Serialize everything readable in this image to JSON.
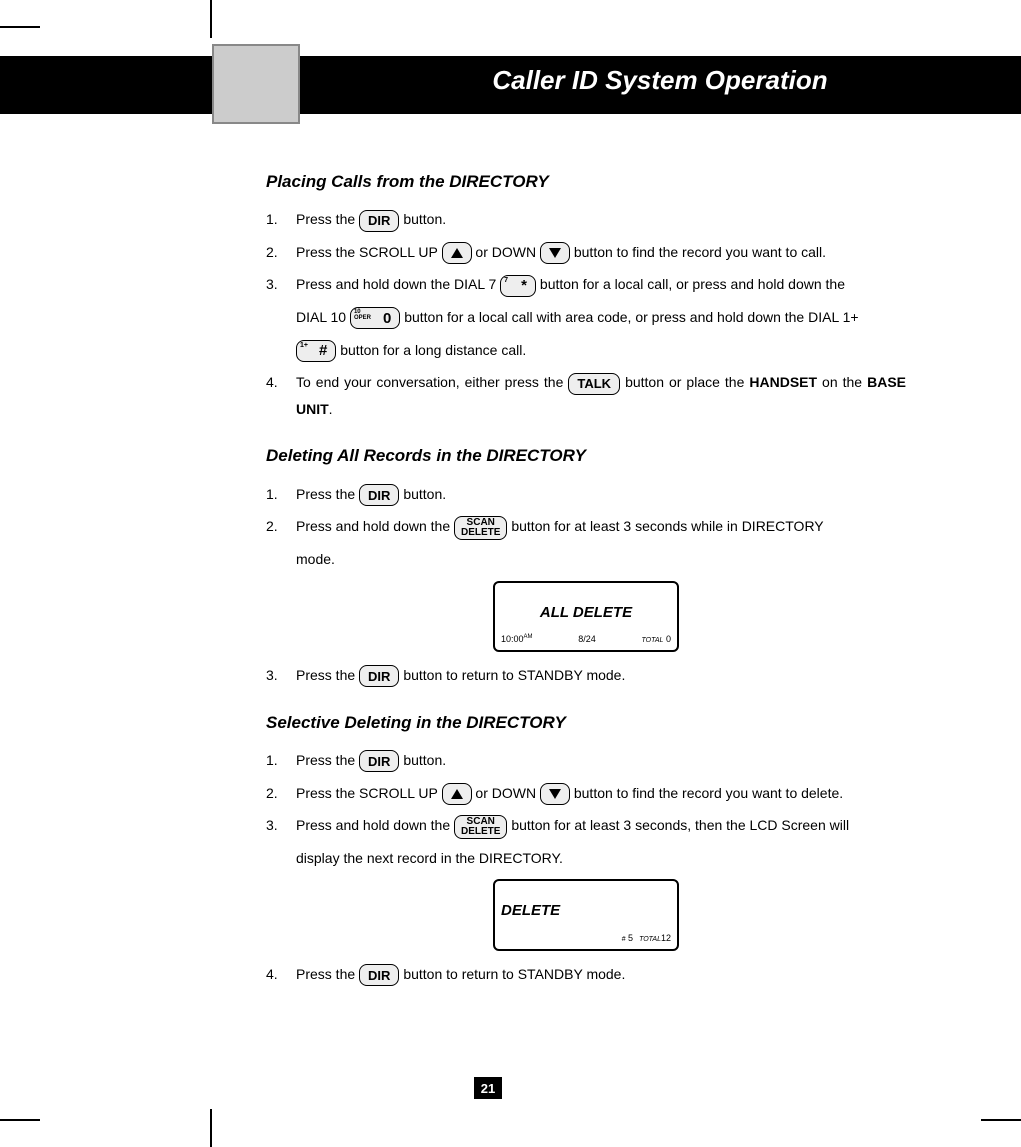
{
  "header": {
    "title": "Caller ID System Operation"
  },
  "page_number": "21",
  "sections": {
    "placing": {
      "heading": "Placing Calls from the DIRECTORY",
      "s1_a": "Press the ",
      "s1_b": " button.",
      "s2_a": "Press the SCROLL UP ",
      "s2_b": " or DOWN ",
      "s2_c": " button to find the record you want to call.",
      "s3_a": "Press and hold down the DIAL 7 ",
      "s3_b": " button for a local call, or press and hold down the",
      "s3_c": "DIAL 10 ",
      "s3_d": " button for a local call with area code, or press and hold down the DIAL 1+",
      "s3_e": " button for a long distance call.",
      "s4_a": "To end your conversation, either press the ",
      "s4_b": " button or place the ",
      "s4_c": "HANDSET",
      "s4_d": " on the ",
      "s4_e": "BASE UNIT",
      "s4_f": "."
    },
    "delete_all": {
      "heading": "Deleting All Records in the DIRECTORY",
      "s1_a": "Press the ",
      "s1_b": " button.",
      "s2_a": "Press and hold down the ",
      "s2_b": " button for at least 3 seconds while in DIRECTORY",
      "s2_c": "mode.",
      "s3_a": "Press the ",
      "s3_b": " button to return to STANDBY mode."
    },
    "delete_sel": {
      "heading": "Selective Deleting in the DIRECTORY",
      "s1_a": "Press the ",
      "s1_b": " button.",
      "s2_a": "Press the SCROLL UP ",
      "s2_b": " or DOWN ",
      "s2_c": " button to find the record you want to delete.",
      "s3_a": "Press and hold down the ",
      "s3_b": " button for at least 3 seconds, then the LCD Screen will",
      "s3_c": "display the next record in the DIRECTORY.",
      "s4_a": "Press the ",
      "s4_b": " button to return to STANDBY mode."
    }
  },
  "buttons": {
    "dir": "DIR",
    "talk": "TALK",
    "scan_l1": "SCAN",
    "scan_l2": "DELETE",
    "key7_corner": "7",
    "key7_main": "*",
    "key10_corner1": "10",
    "key10_corner2": "OPER",
    "key10_main": "0",
    "keyhash_corner": "1+",
    "keyhash_main": "#"
  },
  "lcd1": {
    "main": "ALL DELETE",
    "time": "10:00",
    "ampm": "AM",
    "date": "8/24",
    "total_label": "TOTAL",
    "total_val": "0"
  },
  "lcd2": {
    "main": "DELETE",
    "hash_label": "#",
    "hash_val": "5",
    "total_label": "TOTAL",
    "total_val": "12"
  },
  "nums": {
    "n1": "1.",
    "n2": "2.",
    "n3": "3.",
    "n4": "4."
  }
}
